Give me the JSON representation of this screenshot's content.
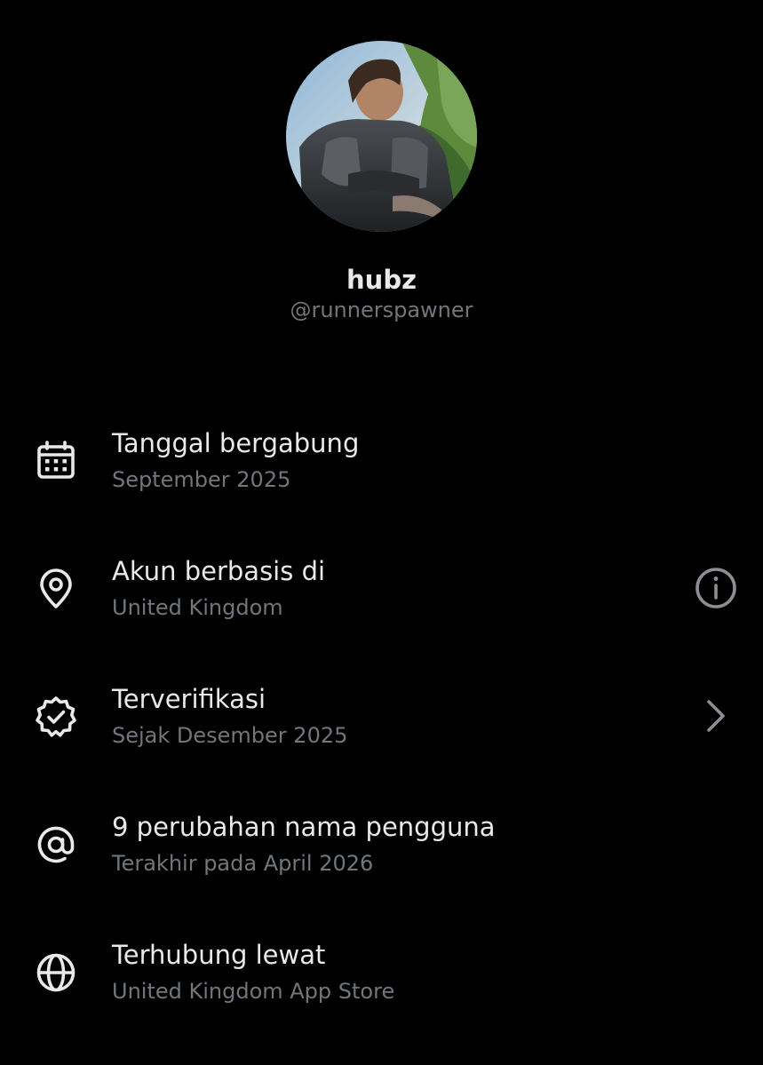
{
  "profile": {
    "display_name": "hubz",
    "handle": "@runnerspawner"
  },
  "colors": {
    "background": "#000000",
    "primary_text": "#e7e9ea",
    "secondary_text": "#71767b"
  },
  "rows": [
    {
      "icon": "calendar-icon",
      "title": "Tanggal bergabung",
      "subtitle": "September 2025",
      "action": null
    },
    {
      "icon": "location-pin-icon",
      "title": "Akun berbasis di",
      "subtitle": "United Kingdom",
      "action": "info-icon"
    },
    {
      "icon": "verified-badge-icon",
      "title": "Terverifikasi",
      "subtitle": "Sejak Desember 2025",
      "action": "chevron-right-icon"
    },
    {
      "icon": "at-sign-icon",
      "title": "9 perubahan nama pengguna",
      "subtitle": "Terakhir pada April 2026",
      "action": null
    },
    {
      "icon": "globe-icon",
      "title": "Terhubung lewat",
      "subtitle": "United Kingdom App Store",
      "action": null
    }
  ]
}
